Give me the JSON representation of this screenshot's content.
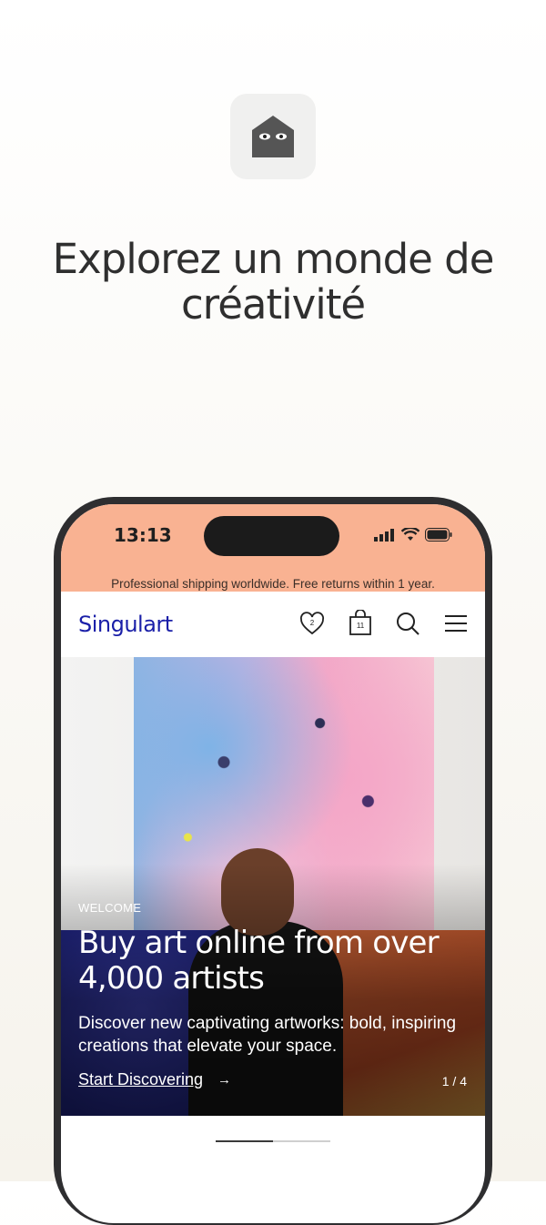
{
  "headline": "Explorez un monde de créativité",
  "app_icon": {
    "name": "singulart-house-icon"
  },
  "status_bar": {
    "time": "13:13"
  },
  "promo_banner": "Professional shipping worldwide. Free returns within 1 year.",
  "nav": {
    "brand": "Singulart",
    "wishlist_count": "2",
    "cart_count": "11",
    "icons": [
      "heart-icon",
      "bag-icon",
      "search-icon",
      "menu-icon"
    ]
  },
  "hero": {
    "eyebrow": "WELCOME",
    "title": "Buy art online from over 4,000 artists",
    "subtitle": "Discover new captivating artworks: bold, inspiring creations that elevate your space.",
    "cta": "Start Discovering",
    "cta_arrow": "→",
    "pager": "1 / 4"
  },
  "carousel_progress": 0.5,
  "colors": {
    "status_bg": "#f9b292",
    "brand": "#1a1fa8",
    "phone_frame": "#2e2e30"
  }
}
